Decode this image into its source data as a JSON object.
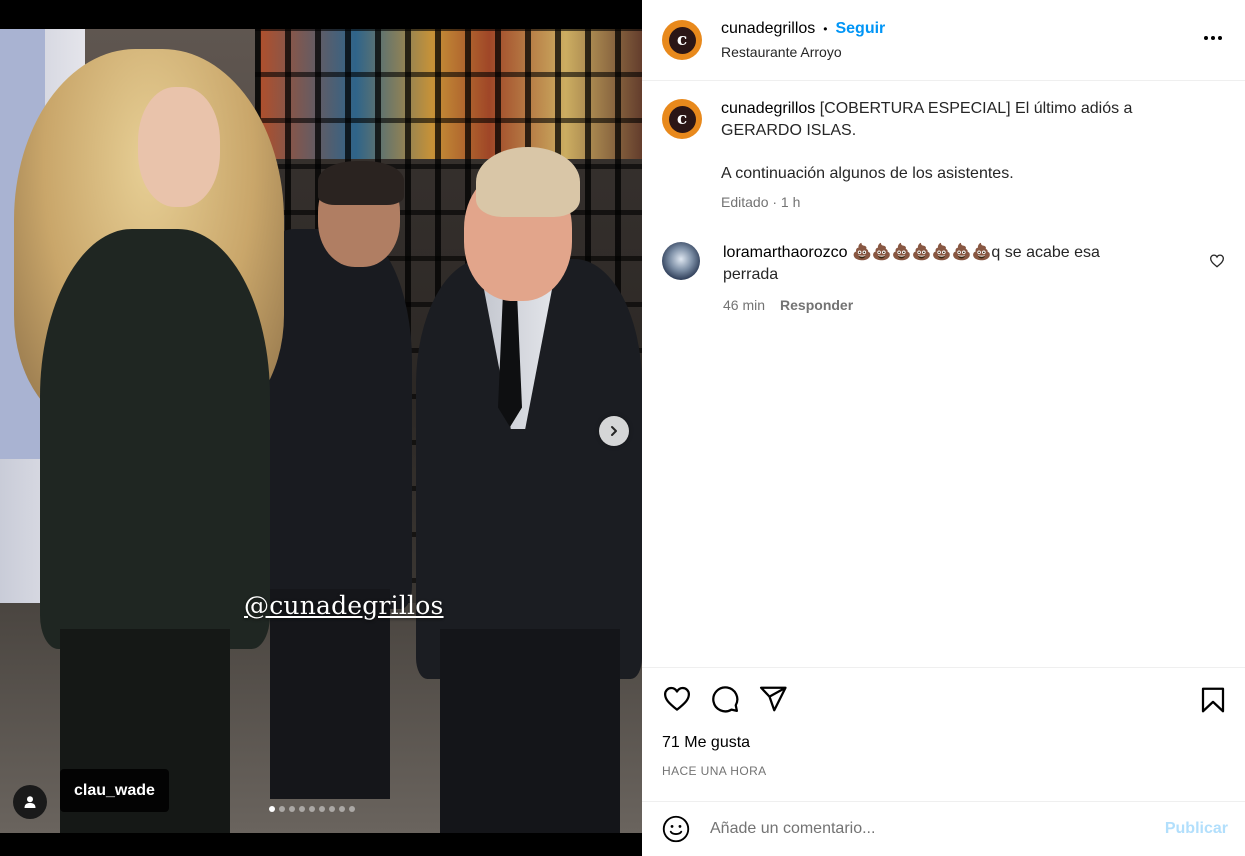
{
  "post": {
    "username": "cunadegrillos",
    "follow_label": "Seguir",
    "location": "Restaurante Arroyo",
    "avatar_letter": "c",
    "caption_line1": "[COBERTURA ESPECIAL] El último adiós a GERARDO ISLAS.",
    "caption_line2": "A continuación algunos de los asistentes.",
    "caption_meta": "Editado · 1 h",
    "watermark": "@cunadegrillos",
    "tagged_user": "clau_wade",
    "carousel": {
      "total": 9,
      "current": 1
    }
  },
  "comments": [
    {
      "username": "loramarthaorozco",
      "emoji": "💩💩💩💩💩💩💩",
      "text": "q se acabe esa perrada",
      "time": "46 min",
      "reply_label": "Responder"
    }
  ],
  "footer": {
    "likes": "71 Me gusta",
    "time_ago": "HACE UNA HORA",
    "comment_placeholder": "Añade un comentario...",
    "publish_label": "Publicar"
  },
  "icons": {
    "like": "heart-icon",
    "comment": "comment-icon",
    "share": "send-icon",
    "save": "bookmark-icon",
    "more": "more-options-icon",
    "emoji": "emoji-icon",
    "next": "chevron-right-icon",
    "tag": "user-tag-icon"
  },
  "colors": {
    "accent": "#0095f6",
    "avatar_ring": "#e8891c",
    "publish_disabled": "#b2dffc"
  }
}
